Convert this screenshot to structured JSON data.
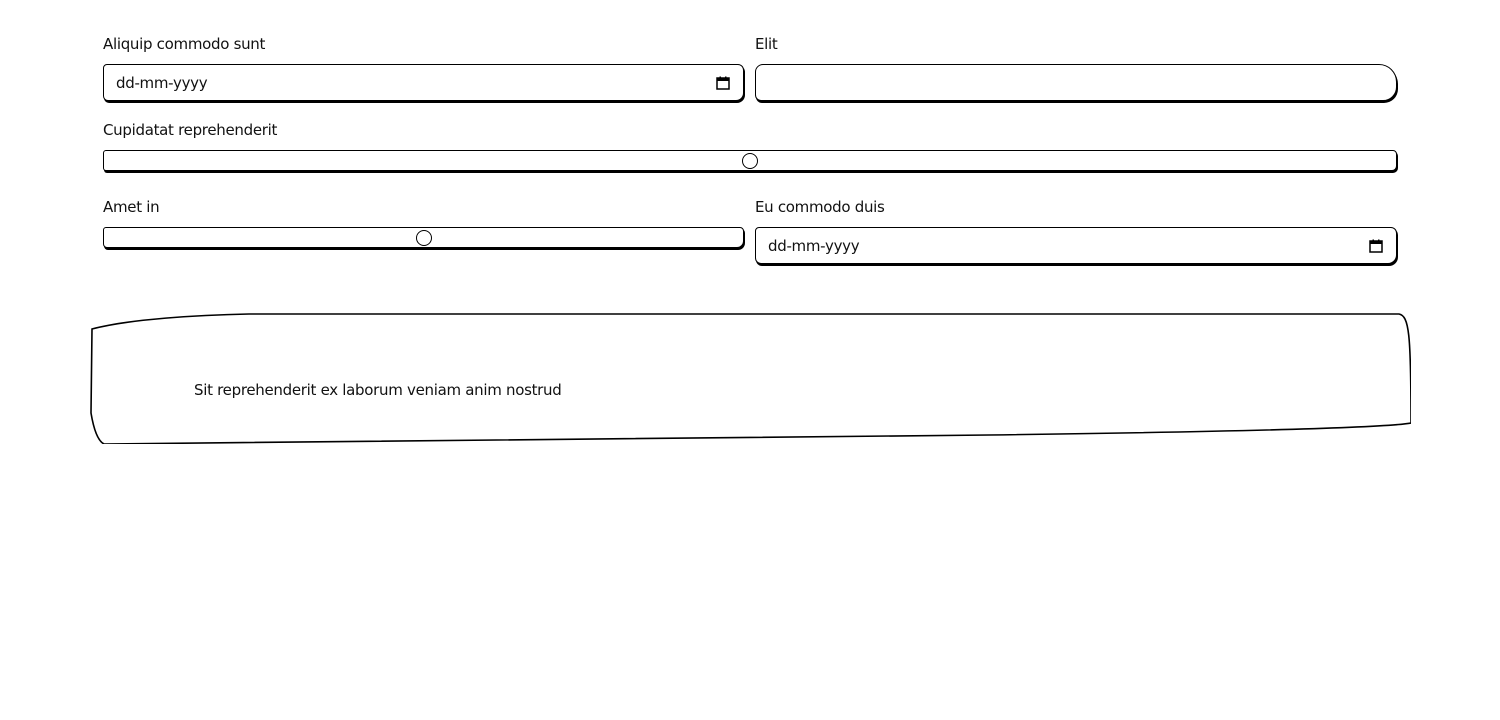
{
  "form": {
    "field1": {
      "label": "Aliquip commodo sunt",
      "placeholder": "dd-mm-yyyy"
    },
    "field2": {
      "label": "Elit",
      "value": ""
    },
    "field3": {
      "label": "Cupidatat reprehenderit",
      "value_fraction": 0.5
    },
    "field4": {
      "label": "Amet in",
      "value_fraction": 0.5
    },
    "field5": {
      "label": "Eu commodo duis",
      "placeholder": "dd-mm-yyyy"
    }
  },
  "banner": {
    "text": "Sit reprehenderit ex laborum veniam anim nostrud"
  },
  "icons": {
    "date_picker": "calendar-icon"
  },
  "colors": {
    "stroke": "#000000",
    "background": "#ffffff"
  }
}
